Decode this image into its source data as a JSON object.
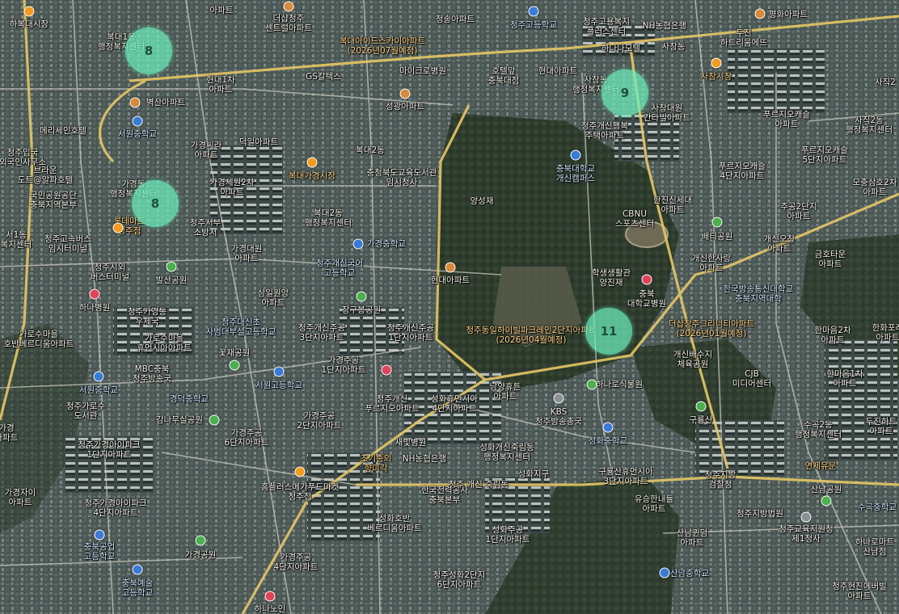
{
  "clusters": [
    {
      "count": "8"
    },
    {
      "count": "9"
    },
    {
      "count": "8"
    },
    {
      "count": "11"
    }
  ],
  "labels": [
    "하복대시장",
    "복대1동\n행정복지센터",
    "아파트",
    "더샵청주\n센트럴아파트",
    "청송아파트",
    "청주고등학교",
    "청주고용복지\n플러스센터",
    "NH농협은행",
    "평화아파트",
    "두진\n하트리움에뜨",
    "사창동",
    "사창시장",
    "사직2",
    "복대아이드스카이아파트\n(2026년07월예정)",
    "마이크로병원",
    "호텔앞\n충북대점",
    "현대아파트",
    "하나나모텔",
    "GS칼텍스",
    "현대1차\n아파트",
    "메리세인호텔",
    "벽산아파트",
    "서원중학교",
    "성광아파트",
    "사창동\n행정복지센터",
    "사창대원\n칸타빌아파트",
    "푸르지오캐슬\n아파트",
    "사직2동\n행정복지센터",
    "청주개신행복\n주택아파트",
    "가경씨라\n아파트",
    "덕일아파트",
    "복대2동",
    "청주입국\n외국인사무소",
    "브라운\n도트@알파호텔",
    "푸르지오캐슬\n5단지아파트",
    "충북대학교\n개신캠퍼스",
    "충청북도교육도서관\n임시청사",
    "복대가경시장",
    "가경동\n행정복지센터",
    "가경세원2차\n아파트",
    "국민공원공단\n충북지역본부",
    "양성재",
    "푸르지오캐슬\n4단지아파트",
    "모충삼호2차\n아파트",
    "한진신세대\n아파트",
    "CBNU\n스포츠센터",
    "주공2단지\n아파트",
    "복대2동\n행정복지센터",
    "롯데마트\n청주점",
    "청주서부\n소방서",
    "서1동\n복지센터",
    "청주고속버스\n임시터미널",
    "가경중학교",
    "배티공원",
    "개신오창\n아파트",
    "가경대원\n아파트",
    "청주시외\n버스터미널",
    "청주개신국어\n고등학교",
    "학생생활관\n양진재",
    "금호타운\n아파트",
    "개신한사랑\n아파트",
    "발산공원",
    "청주가경동\n우체국",
    "현대아파트",
    "충북\n대학교병원",
    "한국방송통신대학교\n충북지역대학",
    "하나병원",
    "삼일원앙\n아파트",
    "장구봉공원",
    "가로수마을\n호반베르디움아파트",
    "청주대신초\n사범대부설고등학교",
    "청주개신주공\n3단지아파트",
    "청주개신주공\n1단지아파트",
    "청주동일하이빌파크레인2단지아파트\n(2026년04월예정)",
    "더샵청주그리니티아파트\n(2026년01월예정)",
    "한마음2차\n아파트",
    "한화포레\n아파트",
    "가로수마을\n휴먼시아아파트",
    "꽃재공원",
    "가경주공\n1단지아파트",
    "개신배수지\n체육공원",
    "MBC충북\n청주방송국",
    "서원고등학교",
    "CJB\n미디어센터",
    "한마음1차\n아파트",
    "서원중학교",
    "청주개신\n푸르지오아파트",
    "성화휴먼시아\n4단지아파트",
    "남양휴튼\n아파트",
    "하나로식물원",
    "경덕중학교",
    "청주가로수\n도서관",
    "KBS\n청주방송총국",
    "가경주공\n2단지아파트",
    "구룡산",
    "수곡2동\n행정복지센터",
    "두진하트\n아파트",
    "가경\n아파트",
    "감나무실공원",
    "가경주공\n6단지아파트",
    "새빛병원",
    "성화개신죽림동\n행정복지센터",
    "청주가경아이파크\n1단지아파트",
    "NH농협은행",
    "조기종의\n향미각",
    "성화중학교",
    "성화지구",
    "구룡산휴먼시아\n3단지아파트",
    "청주지방\n검찰청",
    "연제유문",
    "산남공원",
    "가경자이\n아파트",
    "홈플러스메가푸드마켓\n청주점",
    "청주 개신 죽림동",
    "한국전력공사\n충북본부",
    "유승한내들\n아파트",
    "청주지방법원",
    "수곡중학교",
    "청주가경아이파크\n4단지아파트",
    "성화호반\n베르디움아파트",
    "성화주공\n1단지아파트",
    "산남퀸덤\n아파트",
    "청주교육지원청\n제1청사",
    "하나로마트\n산남점",
    "충북공업\n고등학교",
    "가경공원",
    "가경주공\n4단지아파트",
    "청주성화2단지\n6단지아파트",
    "산남중학교",
    "청주현진에버빌\n아파트",
    "충북예술\n고등학교",
    "하나노인"
  ]
}
